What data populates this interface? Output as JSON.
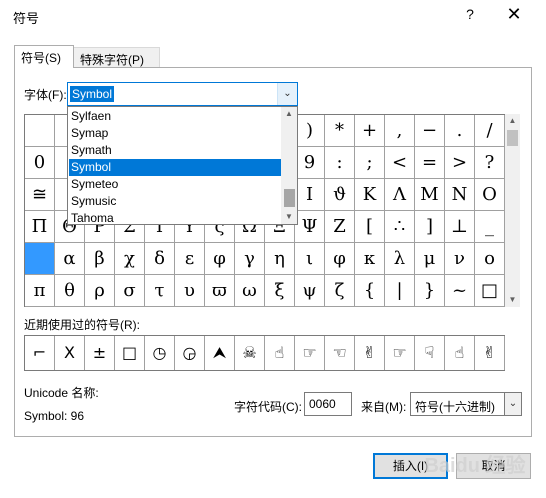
{
  "dialog": {
    "title": "符号",
    "help_label": "?",
    "close_label": "✕"
  },
  "tabs": [
    {
      "label": "符号(S)",
      "active": true
    },
    {
      "label": "特殊字符(P)",
      "active": false
    }
  ],
  "font": {
    "label": "字体(F):",
    "value": "Symbol",
    "options": [
      "Sylfaen",
      "Symap",
      "Symath",
      "Symbol",
      "Symeteo",
      "Symusic",
      "Tahoma"
    ],
    "selected_option": "Symbol"
  },
  "symbol_grid": {
    "rows": [
      [
        "",
        "",
        "",
        "",
        "",
        "",
        "",
        "",
        "",
        ")",
        "*",
        "+",
        ",",
        "−",
        ".",
        "/"
      ],
      [
        "0",
        "",
        "",
        "",
        "",
        "",
        "",
        "",
        "",
        "9",
        ":",
        ";",
        "<",
        "=",
        ">",
        "?"
      ],
      [
        "≅",
        "",
        "",
        "",
        "",
        "",
        "",
        "",
        "",
        "Ι",
        "ϑ",
        "Κ",
        "Λ",
        "Μ",
        "Ν",
        "Ο"
      ],
      [
        "Π",
        "Θ",
        "Ρ",
        "Σ",
        "Τ",
        "Υ",
        "ς",
        "Ω",
        "Ξ",
        "Ψ",
        "Ζ",
        "[",
        "∴",
        "]",
        "⊥",
        "_"
      ],
      [
        "",
        "α",
        "β",
        "χ",
        "δ",
        "ε",
        "φ",
        "γ",
        "η",
        "ι",
        "φ",
        "κ",
        "λ",
        "μ",
        "ν",
        "ο"
      ],
      [
        "π",
        "θ",
        "ρ",
        "σ",
        "τ",
        "υ",
        "ϖ",
        "ω",
        "ξ",
        "ψ",
        "ζ",
        "{",
        "|",
        "}",
        "~",
        "□"
      ]
    ],
    "selected_row": 4,
    "selected_col": 0
  },
  "recent": {
    "label": "近期使用过的符号(R):",
    "symbols": [
      "⌐",
      "Χ",
      "±",
      "□",
      "◷",
      "◶",
      "⮝",
      "☠",
      "☝",
      "☞",
      "☜",
      "✌",
      "☞",
      "☟",
      "☝",
      "✌"
    ]
  },
  "unicode": {
    "name_label": "Unicode 名称:",
    "name_value": "Symbol: 96"
  },
  "char_code": {
    "label": "字符代码(C):",
    "value": "0060"
  },
  "from": {
    "label": "来自(M):",
    "value": "符号(十六进制)"
  },
  "buttons": {
    "insert": "插入(I)",
    "cancel": "取消"
  },
  "watermark": "Baidu 经验"
}
